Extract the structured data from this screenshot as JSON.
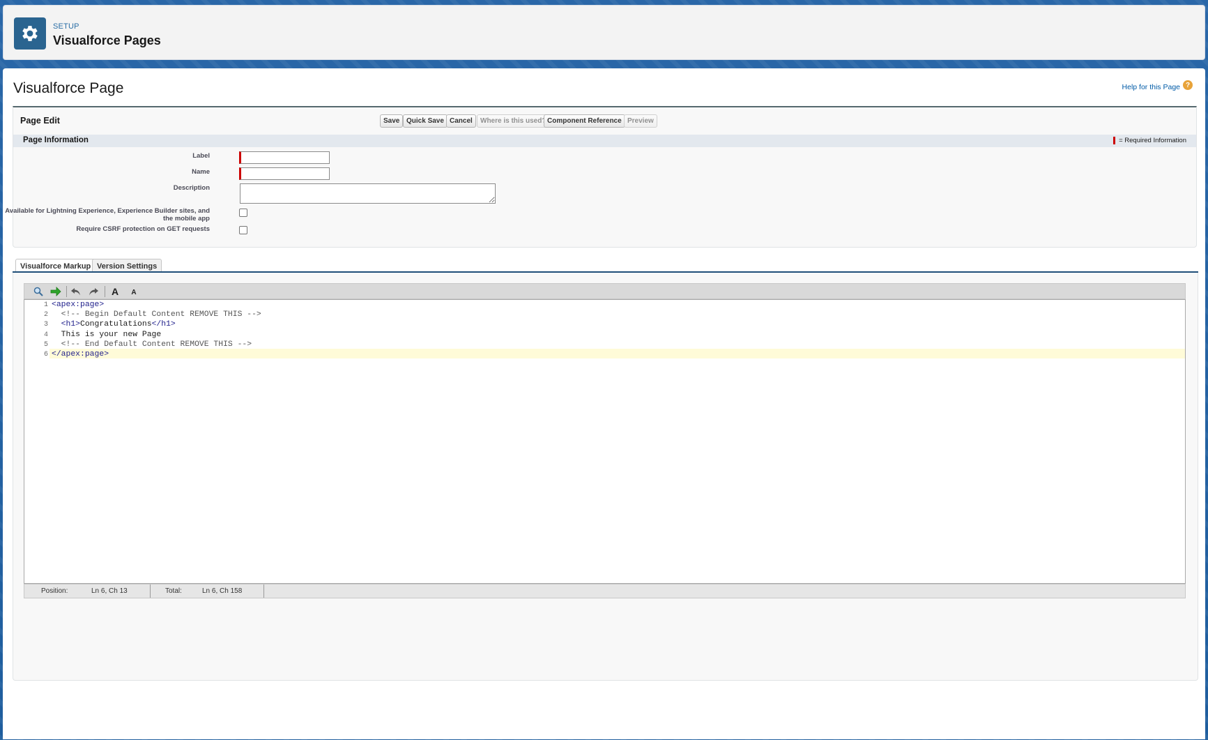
{
  "header": {
    "eyebrow": "SETUP",
    "title": "Visualforce Pages",
    "icon": "gear-icon"
  },
  "page": {
    "title": "Visualforce Page",
    "help_link": "Help for this Page"
  },
  "page_edit": {
    "title": "Page Edit",
    "buttons": {
      "save": "Save",
      "quick_save": "Quick Save",
      "cancel": "Cancel",
      "where_used": "Where is this used?",
      "component_reference": "Component Reference",
      "preview": "Preview"
    },
    "section_title": "Page Information",
    "required_info": "= Required Information",
    "fields": {
      "label": "Label",
      "name": "Name",
      "description": "Description",
      "available_lightning_line1": "Available for Lightning Experience, Experience Builder sites, and",
      "available_lightning_line2": "the mobile app",
      "csrf": "Require CSRF protection on GET requests"
    },
    "values": {
      "label": "",
      "name": "",
      "description": "",
      "available_lightning": false,
      "csrf": false
    }
  },
  "tabs": {
    "markup": "Visualforce Markup",
    "version": "Version Settings"
  },
  "editor": {
    "lines": [
      {
        "no": "1",
        "parts": [
          {
            "t": "<apex:page>",
            "c": "tag"
          }
        ]
      },
      {
        "no": "2",
        "parts": [
          {
            "t": "  <!-- Begin Default Content REMOVE THIS -->",
            "c": "cmt"
          }
        ]
      },
      {
        "no": "3",
        "parts": [
          {
            "t": "  <h1>",
            "c": "tag"
          },
          {
            "t": "Congratulations",
            "c": ""
          },
          {
            "t": "</h1>",
            "c": "tag"
          }
        ]
      },
      {
        "no": "4",
        "parts": [
          {
            "t": "  This is your new Page",
            "c": ""
          }
        ]
      },
      {
        "no": "5",
        "parts": [
          {
            "t": "  <!-- End Default Content REMOVE THIS -->",
            "c": "cmt"
          }
        ]
      },
      {
        "no": "6",
        "parts": [
          {
            "t": "</apex:page>",
            "c": "tag"
          }
        ]
      }
    ],
    "status": {
      "position_label": "Position:",
      "position_value": "Ln 6, Ch 13",
      "total_label": "Total:",
      "total_value": "Ln 6, Ch 158"
    }
  },
  "colors": {
    "brand_blue": "#1b5a9a",
    "required_red": "#cc0000",
    "help_orange": "#e8a33a"
  }
}
